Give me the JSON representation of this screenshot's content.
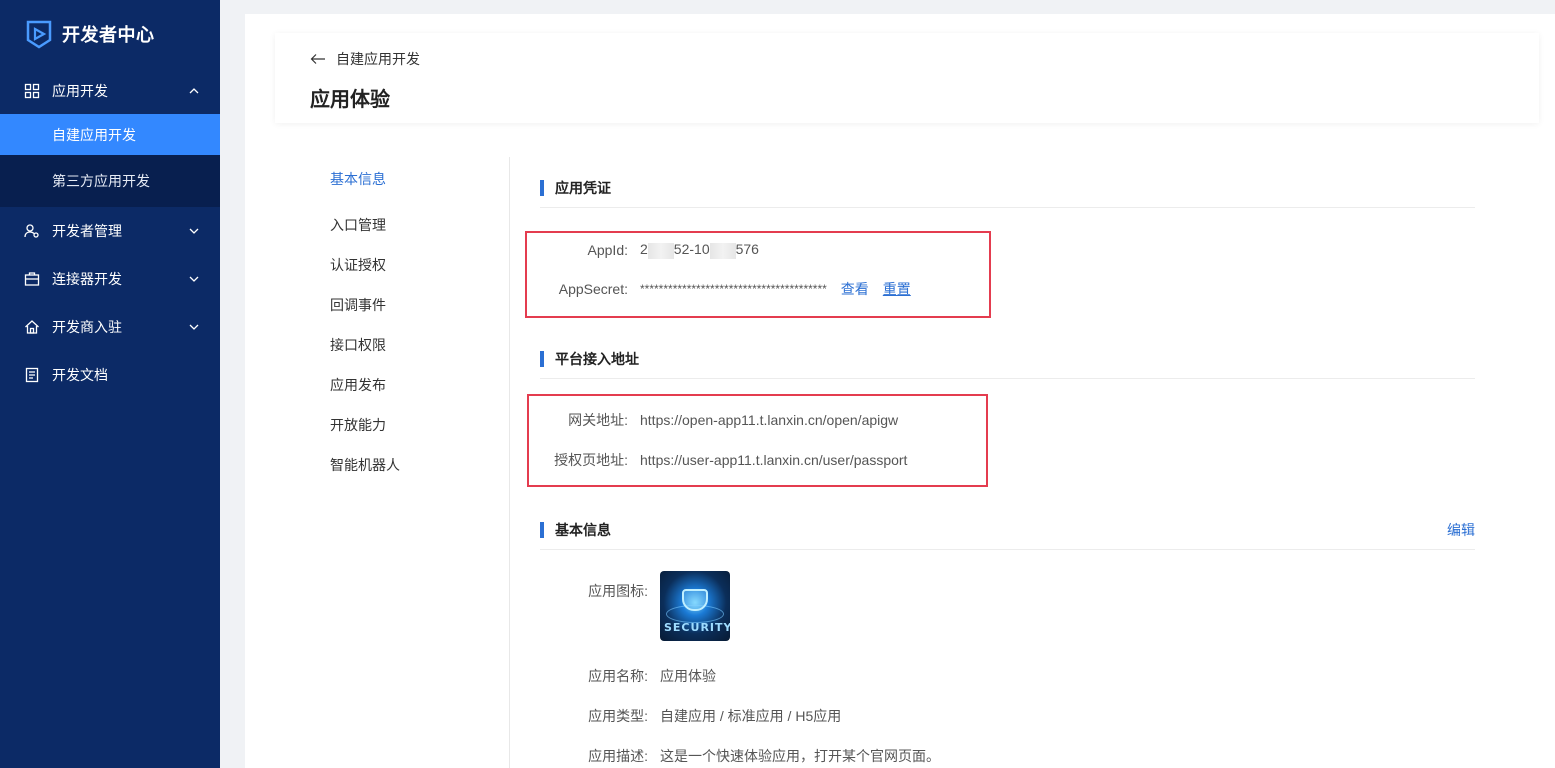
{
  "sidebar": {
    "brand_title": "开发者中心",
    "items": [
      {
        "label": "应用开发",
        "icon": "grid-icon",
        "expanded": true,
        "children": [
          {
            "label": "自建应用开发",
            "active": true
          },
          {
            "label": "第三方应用开发",
            "active": false
          }
        ]
      },
      {
        "label": "开发者管理",
        "icon": "user-settings-icon"
      },
      {
        "label": "连接器开发",
        "icon": "briefcase-icon"
      },
      {
        "label": "开发商入驻",
        "icon": "home-icon"
      },
      {
        "label": "开发文档",
        "icon": "document-icon"
      }
    ]
  },
  "header": {
    "back_label": "自建应用开发",
    "page_title": "应用体验"
  },
  "subnav": [
    {
      "label": "基本信息",
      "active": true
    },
    {
      "label": "入口管理"
    },
    {
      "label": "认证授权"
    },
    {
      "label": "回调事件"
    },
    {
      "label": "接口权限"
    },
    {
      "label": "应用发布"
    },
    {
      "label": "开放能力"
    },
    {
      "label": "智能机器人"
    }
  ],
  "credentials": {
    "title": "应用凭证",
    "appid_label": "AppId:",
    "appid_part1": "2",
    "appid_part2": "52-10",
    "appid_part3": "576",
    "secret_label": "AppSecret:",
    "secret_value": "****************************************",
    "view_label": "查看",
    "reset_label": "重置"
  },
  "platform": {
    "title": "平台接入地址",
    "gateway_label": "网关地址:",
    "gateway_value": "https://open-app11.t.lanxin.cn/open/apigw",
    "auth_label": "授权页地址:",
    "auth_value": "https://user-app11.t.lanxin.cn/user/passport"
  },
  "basic": {
    "title": "基本信息",
    "edit_label": "编辑",
    "icon_label": "应用图标:",
    "icon_text": "SECURITY",
    "name_label": "应用名称:",
    "name_value": "应用体验",
    "type_label": "应用类型:",
    "type_value": "自建应用 / 标准应用 / H5应用",
    "desc_label": "应用描述:",
    "desc_value": "这是一个快速体验应用，打开某个官网页面。"
  },
  "colors": {
    "sidebar_bg": "#0c2a66",
    "active_blue": "#3388ff",
    "link_blue": "#2b6fd3",
    "highlight_red": "#e43c4f"
  }
}
